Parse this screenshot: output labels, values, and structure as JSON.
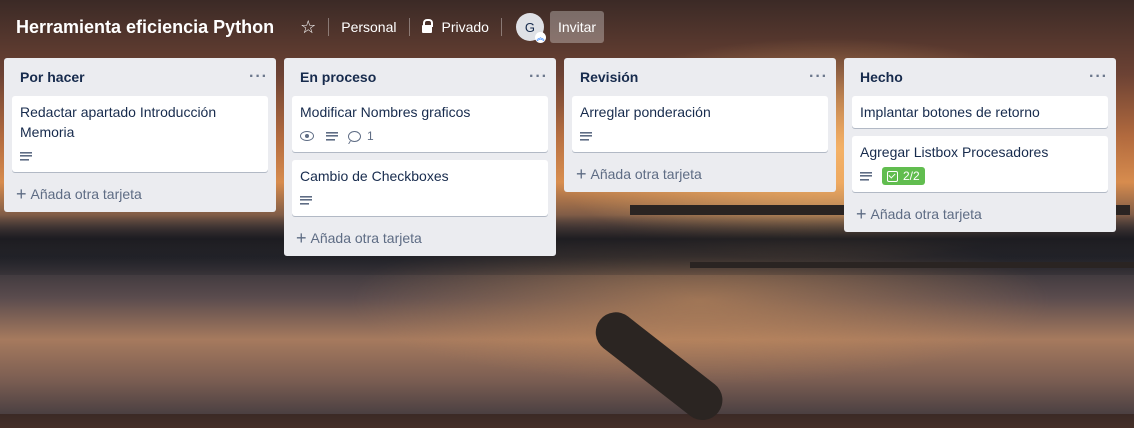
{
  "header": {
    "board_title": "Herramienta eficiencia Python",
    "star_icon": "star-icon",
    "personal_label": "Personal",
    "visibility_label": "Privado",
    "avatar_initial": "G",
    "invite_label": "Invitar"
  },
  "lists": [
    {
      "title": "Por hacer",
      "more": "···",
      "cards": [
        {
          "title": "Redactar apartado Introducción Memoria",
          "badges": [
            "description"
          ]
        }
      ],
      "add_label": "Añada otra tarjeta"
    },
    {
      "title": "En proceso",
      "more": "···",
      "cards": [
        {
          "title": "Modificar Nombres graficos",
          "badges": [
            "watch",
            "description",
            "comments"
          ],
          "comments": "1"
        },
        {
          "title": "Cambio de Checkboxes",
          "badges": [
            "description"
          ]
        }
      ],
      "add_label": "Añada otra tarjeta"
    },
    {
      "title": "Revisión",
      "more": "···",
      "cards": [
        {
          "title": "Arreglar ponderación",
          "badges": [
            "description"
          ]
        }
      ],
      "add_label": "Añada otra tarjeta"
    },
    {
      "title": "Hecho",
      "more": "···",
      "cards": [
        {
          "title": "Implantar botones de retorno",
          "badges": []
        },
        {
          "title": "Agregar Listbox Procesadores",
          "badges": [
            "description",
            "checklist"
          ],
          "checklist": "2/2"
        }
      ],
      "add_label": "Añada otra tarjeta"
    }
  ],
  "colors": {
    "list_bg": "#ebecf0",
    "checklist_complete": "#61bd4f",
    "text_dark": "#172b4d"
  }
}
